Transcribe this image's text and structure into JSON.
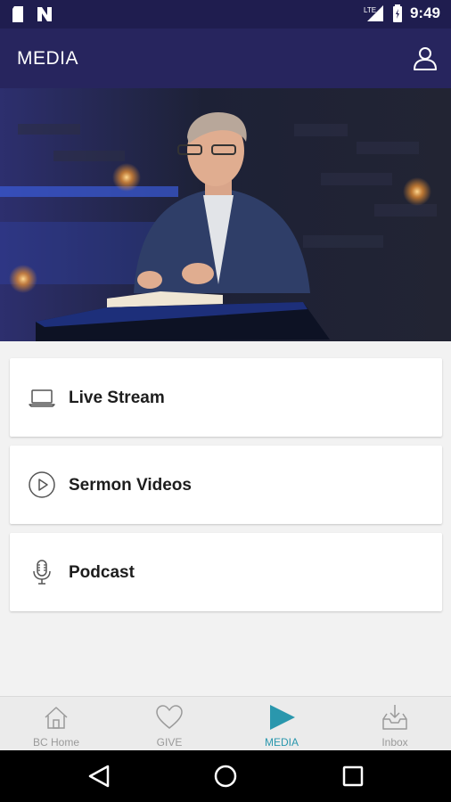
{
  "status_bar": {
    "time": "9:49",
    "network": "LTE",
    "icons": [
      "sd-card-icon",
      "n-notification-icon",
      "signal-icon",
      "battery-icon"
    ]
  },
  "header": {
    "title": "MEDIA",
    "profile_icon": "user-profile-icon",
    "bg_color": "#27255e"
  },
  "menu": {
    "items": [
      {
        "label": "Live Stream",
        "icon": "laptop-icon"
      },
      {
        "label": "Sermon Videos",
        "icon": "play-circle-icon"
      },
      {
        "label": "Podcast",
        "icon": "microphone-icon"
      }
    ]
  },
  "bottom_nav": {
    "items": [
      {
        "label": "BC Home",
        "icon": "home-icon",
        "active": false
      },
      {
        "label": "GIVE",
        "icon": "heart-icon",
        "active": false
      },
      {
        "label": "MEDIA",
        "icon": "play-icon",
        "active": true
      },
      {
        "label": "Inbox",
        "icon": "inbox-icon",
        "active": false
      }
    ],
    "active_color": "#2a97ad",
    "inactive_color": "#9a9a9a"
  },
  "system_nav": {
    "buttons": [
      "back-icon",
      "home-circle-icon",
      "recents-icon"
    ]
  }
}
